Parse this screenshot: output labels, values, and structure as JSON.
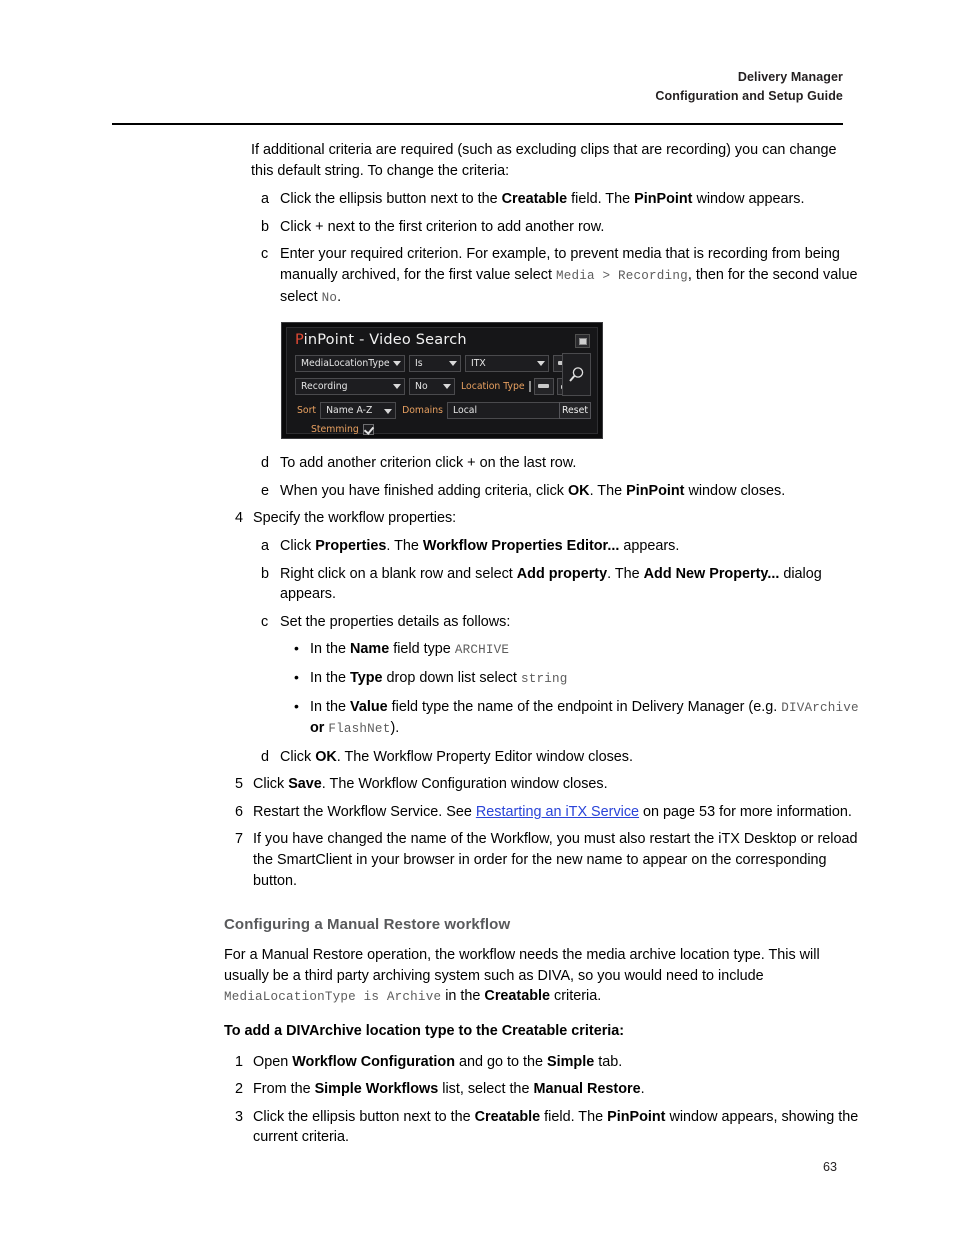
{
  "header": {
    "line1": "Delivery Manager",
    "line2": "Configuration and Setup Guide"
  },
  "page_number": "63",
  "intro": {
    "text": "If additional criteria are required (such as excluding clips that are recording) you can change this default string. To change the criteria:"
  },
  "steps_group1": [
    {
      "marker": "a",
      "parts": [
        {
          "t": "Click the ellipsis button next to the ",
          "s": "n"
        },
        {
          "t": "Creatable",
          "s": "b"
        },
        {
          "t": " field. The ",
          "s": "n"
        },
        {
          "t": "PinPoint",
          "s": "b"
        },
        {
          "t": " window appears.",
          "s": "n"
        }
      ]
    },
    {
      "marker": "b",
      "parts": [
        {
          "t": "Click + next to the first criterion to add another row.",
          "s": "n"
        }
      ]
    },
    {
      "marker": "c",
      "parts": [
        {
          "t": "Enter your required criterion. For example, to prevent media that is recording from being manually archived, for the first value select ",
          "s": "n"
        },
        {
          "t": "Media > Recording",
          "s": "m"
        },
        {
          "t": ", then for the second value select ",
          "s": "n"
        },
        {
          "t": "No",
          "s": "m"
        },
        {
          "t": ".",
          "s": "n"
        }
      ]
    }
  ],
  "steps_group1b": [
    {
      "marker": "d",
      "parts": [
        {
          "t": "To add another criterion click + on the last row.",
          "s": "n"
        }
      ]
    },
    {
      "marker": "e",
      "parts": [
        {
          "t": "When you have finished adding criteria, click ",
          "s": "n"
        },
        {
          "t": "OK",
          "s": "b"
        },
        {
          "t": ". The ",
          "s": "n"
        },
        {
          "t": "PinPoint",
          "s": "b"
        },
        {
          "t": " window closes.",
          "s": "n"
        }
      ]
    }
  ],
  "step4": {
    "marker": "4",
    "parts": [
      {
        "t": "Specify the workflow properties:",
        "s": "n"
      }
    ]
  },
  "step4_subs": [
    {
      "marker": "a",
      "parts": [
        {
          "t": "Click ",
          "s": "n"
        },
        {
          "t": "Properties",
          "s": "b"
        },
        {
          "t": ". The ",
          "s": "n"
        },
        {
          "t": "Workflow Properties Editor...",
          "s": "b"
        },
        {
          "t": " appears.",
          "s": "n"
        }
      ]
    },
    {
      "marker": "b",
      "parts": [
        {
          "t": "Right click on a blank row and select ",
          "s": "n"
        },
        {
          "t": "Add property",
          "s": "b"
        },
        {
          "t": ". The ",
          "s": "n"
        },
        {
          "t": "Add New Property...",
          "s": "b"
        },
        {
          "t": " dialog appears.",
          "s": "n"
        }
      ]
    },
    {
      "marker": "c",
      "parts": [
        {
          "t": "Set the properties details as follows:",
          "s": "n"
        }
      ]
    }
  ],
  "step4c_bullets": [
    {
      "marker": "•",
      "parts": [
        {
          "t": "In the ",
          "s": "n"
        },
        {
          "t": "Name",
          "s": "b"
        },
        {
          "t": " field type ",
          "s": "n"
        },
        {
          "t": "ARCHIVE",
          "s": "m"
        }
      ]
    },
    {
      "marker": "•",
      "parts": [
        {
          "t": "In the ",
          "s": "n"
        },
        {
          "t": "Type",
          "s": "b"
        },
        {
          "t": " drop down list select ",
          "s": "n"
        },
        {
          "t": "string",
          "s": "m"
        }
      ]
    },
    {
      "marker": "•",
      "parts": [
        {
          "t": "In the ",
          "s": "n"
        },
        {
          "t": "Value",
          "s": "b"
        },
        {
          "t": " field type the name of the endpoint in Delivery Manager (e.g. ",
          "s": "n"
        },
        {
          "t": "DIVArchive",
          "s": "m"
        },
        {
          "t": " or ",
          "s": "b"
        },
        {
          "t": "FlashNet",
          "s": "m"
        },
        {
          "t": ").",
          "s": "n"
        }
      ]
    }
  ],
  "step4d": {
    "marker": "d",
    "parts": [
      {
        "t": "Click ",
        "s": "n"
      },
      {
        "t": "OK",
        "s": "b"
      },
      {
        "t": ". The Workflow Property Editor window closes.",
        "s": "n"
      }
    ]
  },
  "steps_tail": [
    {
      "marker": "5",
      "parts": [
        {
          "t": "Click ",
          "s": "n"
        },
        {
          "t": "Save",
          "s": "b"
        },
        {
          "t": ". The Workflow Configuration window closes.",
          "s": "n"
        }
      ]
    },
    {
      "marker": "6",
      "parts": [
        {
          "t": "Restart the Workflow Service. See ",
          "s": "n"
        },
        {
          "t": "Restarting an iTX Service",
          "s": "l"
        },
        {
          "t": " on page 53 for more information.",
          "s": "n"
        }
      ]
    },
    {
      "marker": "7",
      "parts": [
        {
          "t": "If you have changed the name of the Workflow, you must also restart the iTX Desktop or reload the SmartClient in your browser in order for the new name to appear on the corresponding button.",
          "s": "n"
        }
      ]
    }
  ],
  "section": {
    "heading": "Configuring a Manual Restore workflow",
    "paragraph_parts": [
      {
        "t": "For a Manual Restore operation, the workflow needs the media archive location type. This will usually be a third party archiving system such as DIVA, so you would need to include ",
        "s": "n"
      },
      {
        "t": "MediaLocationType is Archive",
        "s": "m"
      },
      {
        "t": " in the ",
        "s": "n"
      },
      {
        "t": "Creatable",
        "s": "b"
      },
      {
        "t": " criteria.",
        "s": "n"
      }
    ],
    "lead_in": "To add a DIVArchive location type to the Creatable criteria:"
  },
  "steps_group2": [
    {
      "marker": "1",
      "parts": [
        {
          "t": "Open ",
          "s": "n"
        },
        {
          "t": "Workflow Configuration",
          "s": "b"
        },
        {
          "t": " and go to the ",
          "s": "n"
        },
        {
          "t": "Simple",
          "s": "b"
        },
        {
          "t": " tab.",
          "s": "n"
        }
      ]
    },
    {
      "marker": "2",
      "parts": [
        {
          "t": "From the ",
          "s": "n"
        },
        {
          "t": "Simple Workflows",
          "s": "b"
        },
        {
          "t": " list, select the ",
          "s": "n"
        },
        {
          "t": "Manual Restore",
          "s": "b"
        },
        {
          "t": ".",
          "s": "n"
        }
      ]
    },
    {
      "marker": "3",
      "parts": [
        {
          "t": "Click the ellipsis button next to the ",
          "s": "n"
        },
        {
          "t": "Creatable",
          "s": "b"
        },
        {
          "t": " field. The ",
          "s": "n"
        },
        {
          "t": "PinPoint",
          "s": "b"
        },
        {
          "t": " window appears, showing the current criteria.",
          "s": "n"
        }
      ]
    }
  ],
  "pinpoint_dialog": {
    "title_accent": "P",
    "title_rest": "inPoint - Video Search",
    "accent_color": "#e24a34",
    "criteria_rows": [
      {
        "field": "MediaLocationType",
        "operator": "Is",
        "value": "ITX",
        "remove_label": "−"
      },
      {
        "field": "Recording",
        "operator": "No",
        "extra_label": "Location Type",
        "remove_label": "−",
        "add_label": "+"
      }
    ],
    "sort_label": "Sort",
    "sort_value": "Name A-Z",
    "domains_label": "Domains",
    "domains_value": "Local",
    "stemming_label": "Stemming",
    "stemming_checked": true,
    "reset_label": "Reset",
    "search_icon": "magnifier-icon",
    "maximize_icon": "maximize-icon",
    "label_color": "#e8a060"
  }
}
